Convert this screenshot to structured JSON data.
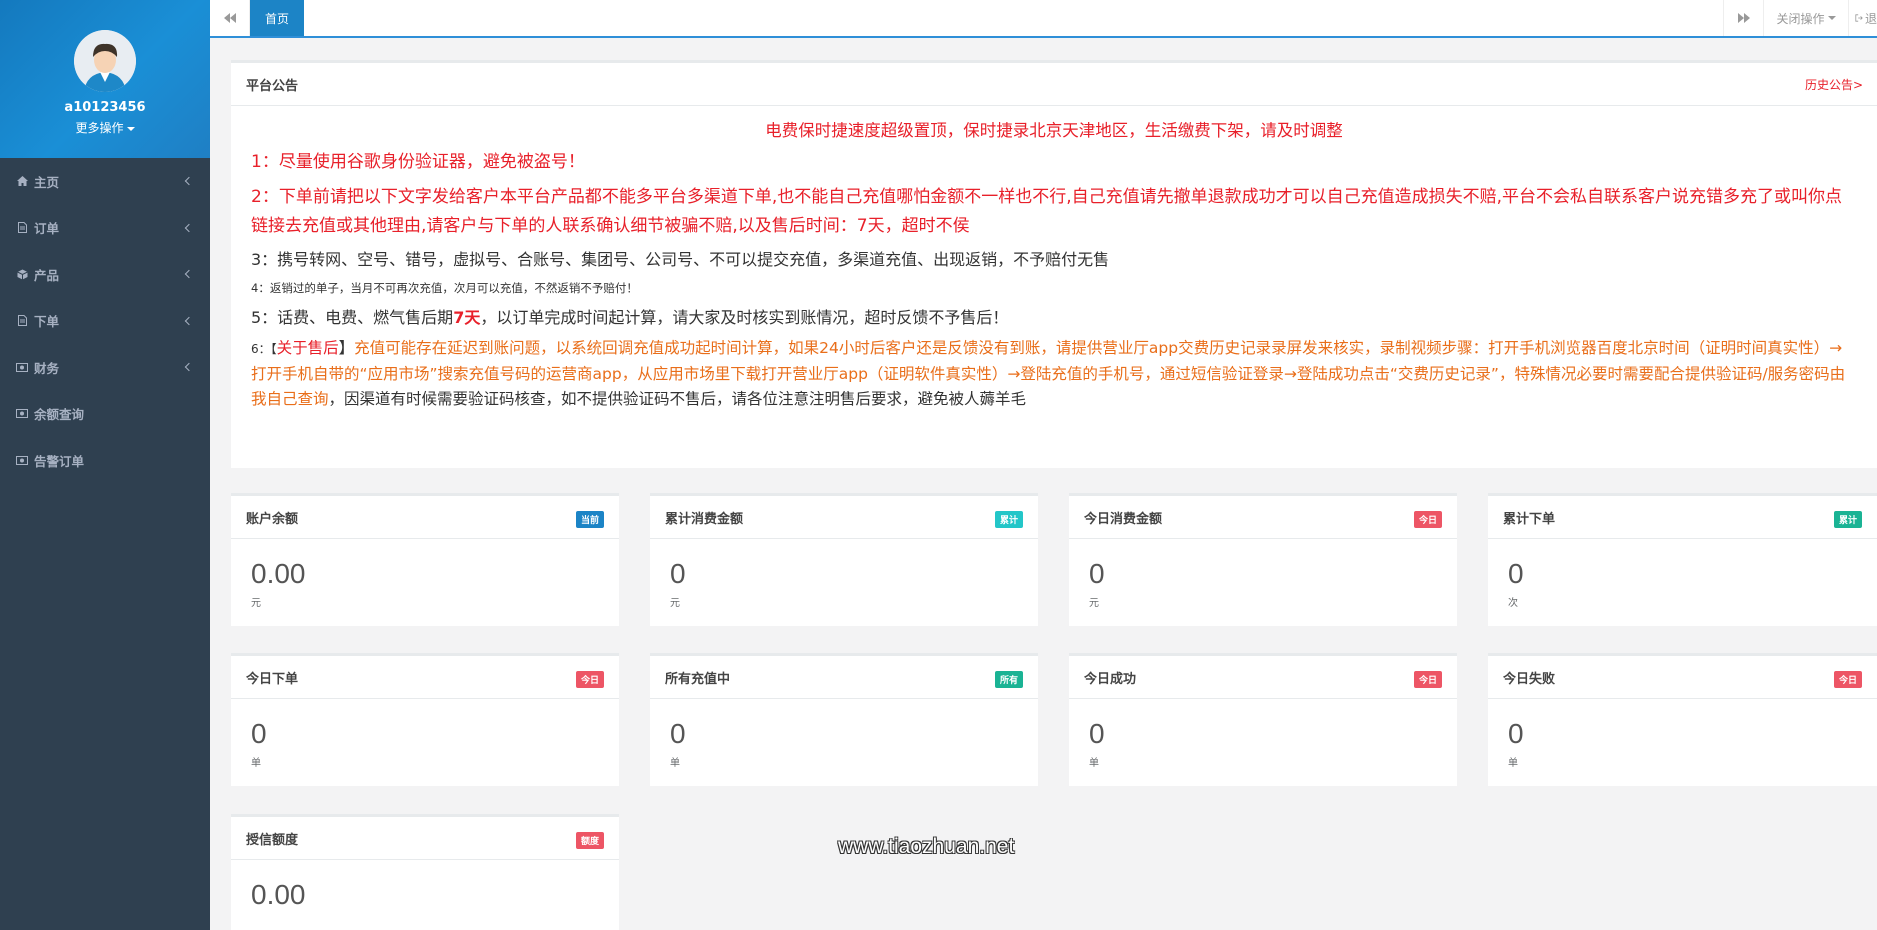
{
  "sidebar": {
    "username": "a10123456",
    "more_label": "更多操作",
    "items": [
      {
        "label": "主页",
        "icon": "home-icon"
      },
      {
        "label": "订单",
        "icon": "file-icon"
      },
      {
        "label": "产品",
        "icon": "cube-icon"
      },
      {
        "label": "下单",
        "icon": "file-icon"
      },
      {
        "label": "财务",
        "icon": "money-icon"
      },
      {
        "label": "余额查询",
        "icon": "money-icon"
      },
      {
        "label": "告警订单",
        "icon": "money-icon"
      }
    ]
  },
  "topbar": {
    "home_tab": "首页",
    "close_ops": "关闭操作",
    "logout_partial": "退"
  },
  "notice": {
    "title": "平台公告",
    "history_link": "历史公告>",
    "headline": "电费保时捷速度超级置顶，保时捷录北京天津地区，生活缴费下架，请及时调整",
    "line1": "1：尽量使用谷歌身份验证器，避免被盗号！",
    "line2": "2：下单前请把以下文字发给客户本平台产品都不能多平台多渠道下单,也不能自己充值哪怕金额不一样也不行,自己充值请先撤单退款成功才可以自己充值造成损失不赔,平台不会私自联系客户说充错多充了或叫你点链接去充值或其他理由,请客户与下单的人联系确认细节被骗不赔,以及售后时间：7天，超时不侯",
    "line3": "3：携号转网、空号、错号，虚拟号、合账号、集团号、公司号、不可以提交充值，多渠道充值、出现返销，不予赔付无售",
    "line4": "4：返销过的单子，当月不可再次充值，次月可以充值，不然返销不予赔付！",
    "line5_a": "5：话费、电费、燃气售后期",
    "line5_b": "7天",
    "line5_c": "，以订单完成时间起计算，请大家及时核实到账情况，超时反馈不予售后！",
    "line6_prefix": "6：【",
    "line6_tag": "关于售后",
    "line6_bracket": "】",
    "line6_body": "充值可能存在延迟到账问题，以系统回调充值成功起时间计算，如果24小时后客户还是反馈没有到账，请提供营业厅app交费历史记录录屏发来核实，录制视频步骤：打开手机浏览器百度北京时间（证明时间真实性）→打开手机自带的“应用市场”搜索充值号码的运营商app，从应用市场里下载打开营业厅app（证明软件真实性）→登陆充值的手机号，通过短信验证登录→登陆成功点击“交费历史记录”，特殊情况必要时需要配合提供验证码/服务密码由我自己查询",
    "line6_tail": "，因渠道有时候需要验证码核查，如不提供验证码不售后，请各位注意注明售后要求，避免被人薅羊毛"
  },
  "stats": [
    {
      "title": "账户余额",
      "badge": "当前",
      "badge_color": "#1c84c6",
      "value": "0.00",
      "unit": "元"
    },
    {
      "title": "累计消费金额",
      "badge": "累计",
      "badge_color": "#23c6c8",
      "value": "0",
      "unit": "元"
    },
    {
      "title": "今日消费金额",
      "badge": "今日",
      "badge_color": "#ed5565",
      "value": "0",
      "unit": "元"
    },
    {
      "title": "累计下单",
      "badge": "累计",
      "badge_color": "#1ab394",
      "value": "0",
      "unit": "次"
    },
    {
      "title": "今日下单",
      "badge": "今日",
      "badge_color": "#ed5565",
      "value": "0",
      "unit": "单"
    },
    {
      "title": "所有充值中",
      "badge": "所有",
      "badge_color": "#1ab394",
      "value": "0",
      "unit": "单"
    },
    {
      "title": "今日成功",
      "badge": "今日",
      "badge_color": "#ed5565",
      "value": "0",
      "unit": "单"
    },
    {
      "title": "今日失败",
      "badge": "今日",
      "badge_color": "#ed5565",
      "value": "0",
      "unit": "单"
    },
    {
      "title": "授信额度",
      "badge": "额度",
      "badge_color": "#ed5565",
      "value": "0.00",
      "unit": ""
    }
  ],
  "watermark": "www.tiaozhuan.net"
}
